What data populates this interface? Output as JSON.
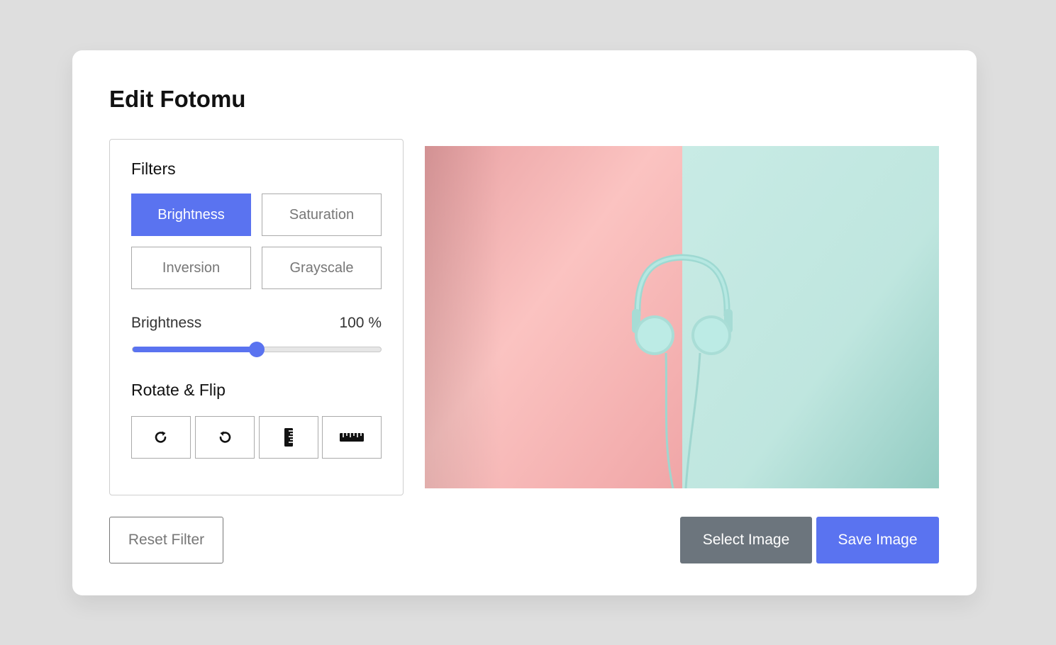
{
  "title": "Edit Fotomu",
  "filters": {
    "heading": "Filters",
    "buttons": [
      {
        "label": "Brightness",
        "active": true
      },
      {
        "label": "Saturation",
        "active": false
      },
      {
        "label": "Inversion",
        "active": false
      },
      {
        "label": "Grayscale",
        "active": false
      }
    ]
  },
  "slider": {
    "label": "Brightness",
    "value_text": "100 %",
    "fraction": 0.5
  },
  "rotate_flip": {
    "heading": "Rotate & Flip",
    "buttons": [
      {
        "icon": "rotate-right-icon"
      },
      {
        "icon": "rotate-left-icon"
      },
      {
        "icon": "flip-vertical-icon"
      },
      {
        "icon": "flip-horizontal-icon"
      }
    ]
  },
  "actions": {
    "reset": "Reset Filter",
    "select": "Select Image",
    "save": "Save Image"
  },
  "colors": {
    "accent": "#5a73f0",
    "secondary": "#6c757d",
    "photo_left": "#f7b9b8",
    "photo_right": "#bde5df"
  }
}
